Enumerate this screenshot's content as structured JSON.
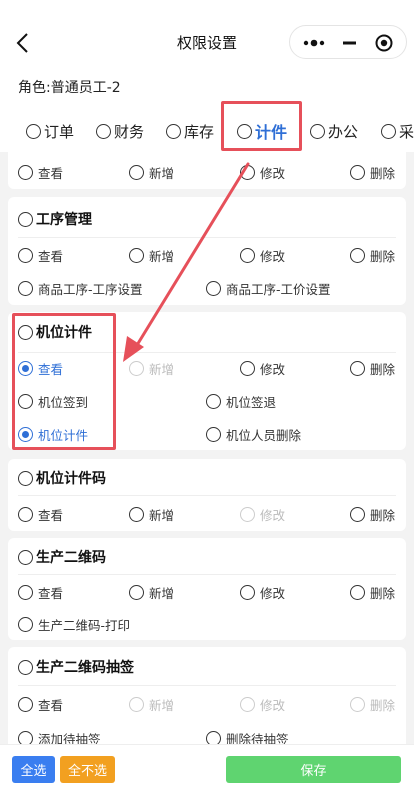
{
  "header": {
    "title": "权限设置"
  },
  "role": {
    "label": "角色:",
    "value": "普通员工-2"
  },
  "tabs": [
    {
      "label": "订单",
      "active": false
    },
    {
      "label": "财务",
      "active": false
    },
    {
      "label": "库存",
      "active": false
    },
    {
      "label": "计件",
      "active": true
    },
    {
      "label": "办公",
      "active": false
    },
    {
      "label": "采",
      "active": false
    }
  ],
  "top_partial": {
    "options": [
      "查看",
      "新增",
      "修改",
      "删除"
    ]
  },
  "sections": [
    {
      "title": "工序管理",
      "row1": [
        "查看",
        "新增",
        "修改",
        "删除"
      ],
      "row2": [
        "商品工序-工序设置",
        "商品工序-工价设置"
      ]
    },
    {
      "title": "机位计件",
      "row1": [
        "查看",
        "新增",
        "修改",
        "删除"
      ],
      "row2": [
        "机位签到",
        "机位签退"
      ],
      "row3": [
        "机位计件",
        "机位人员删除"
      ],
      "checked": [
        "查看",
        "机位计件"
      ],
      "disabled": [
        "新增"
      ]
    },
    {
      "title": "机位计件码",
      "row1": [
        "查看",
        "新增",
        "修改",
        "删除"
      ],
      "disabled": [
        "修改"
      ]
    },
    {
      "title": "生产二维码",
      "row1": [
        "查看",
        "新增",
        "修改",
        "删除"
      ],
      "row2": [
        "生产二维码-打印"
      ]
    },
    {
      "title": "生产二维码抽签",
      "row1": [
        "查看",
        "新增",
        "修改",
        "删除"
      ],
      "row2": [
        "添加待抽签",
        "删除待抽签"
      ],
      "disabled": [
        "新增",
        "修改",
        "删除"
      ]
    }
  ],
  "footer": {
    "select_all": "全选",
    "select_none": "全不选",
    "save": "保存"
  },
  "colors": {
    "accent": "#2f6fd6",
    "annotation": "#e6505a",
    "save": "#5fd470",
    "select_none": "#f2a020",
    "select_all": "#3a7ef0"
  }
}
